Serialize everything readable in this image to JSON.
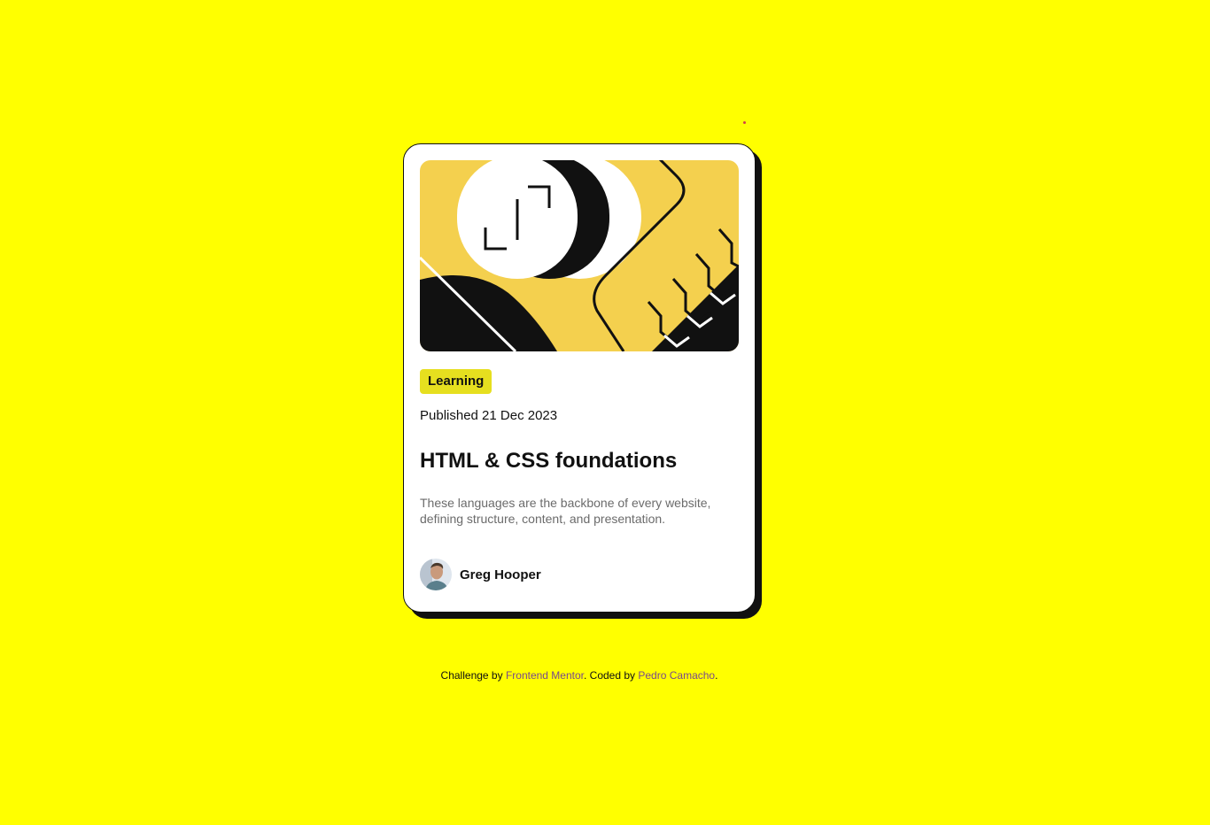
{
  "page": {
    "background_color": "#ffff00"
  },
  "card": {
    "hero_image": {
      "name": "abstract-illustration",
      "colors": {
        "yellow": "#f4d04e",
        "black": "#111111",
        "white": "#ffffff"
      }
    },
    "tag": {
      "label": "Learning",
      "color": "#e6df1f"
    },
    "published": "Published 21 Dec 2023",
    "title": "HTML & CSS foundations",
    "description": "These languages are the backbone of every website, defining structure, content, and presentation.",
    "author": {
      "name": "Greg Hooper",
      "avatar_icon": "user-avatar-photo"
    }
  },
  "footer": {
    "challenge_prefix": "Challenge by ",
    "challenge_link": "Frontend Mentor",
    "coded_prefix": ". Coded by ",
    "coded_link": "Pedro Camacho",
    "suffix": ".",
    "link_color": "#7a4a8a"
  },
  "misc": {
    "stray_dot_color": "#d0404a"
  }
}
